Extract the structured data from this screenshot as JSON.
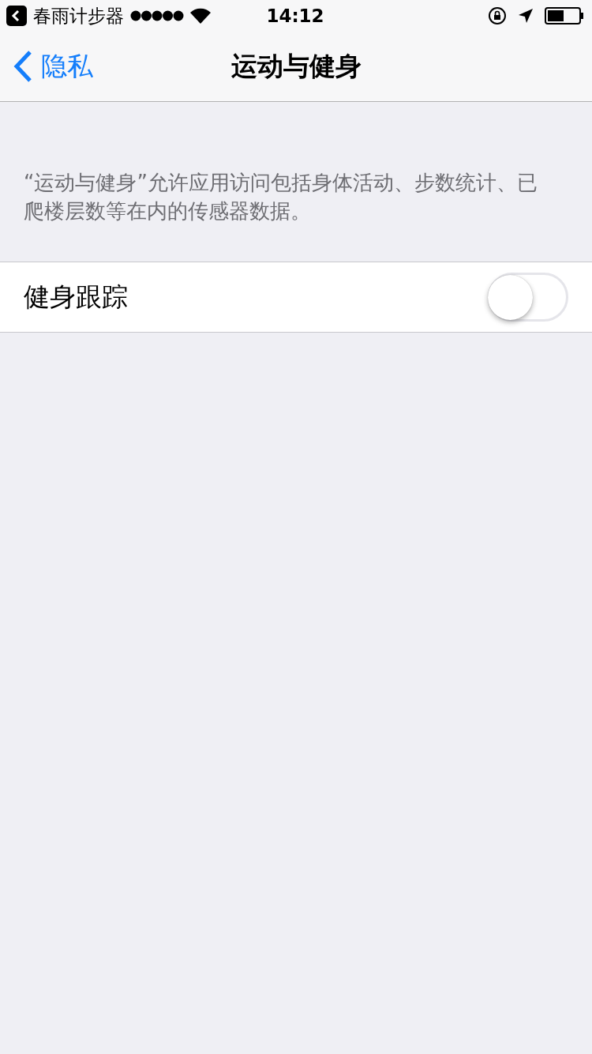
{
  "status_bar": {
    "back_app": "春雨计步器",
    "time": "14:12"
  },
  "nav": {
    "back": "隐私",
    "title": "运动与健身"
  },
  "description": "“运动与健身”允许应用访问包括身体活动、步数统计、已爬楼层数等在内的传感器数据。",
  "settings": [
    {
      "label": "健身跟踪",
      "on": false
    }
  ]
}
